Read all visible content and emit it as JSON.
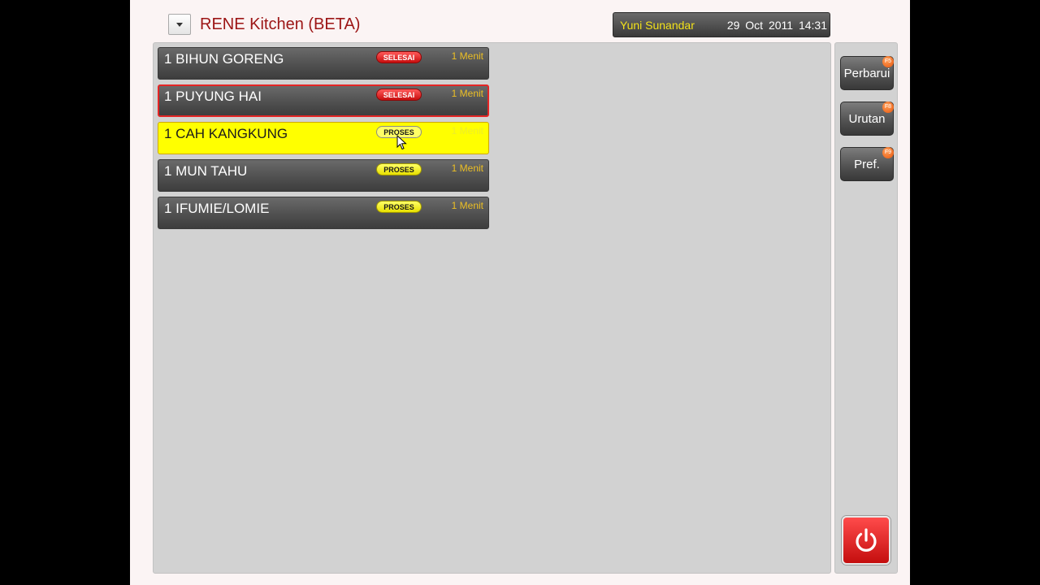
{
  "header": {
    "title": "RENE Kitchen (BETA)",
    "user": "Yuni Sunandar",
    "datetime": "29 Oct 2011 14:31"
  },
  "orders": [
    {
      "name": "1 BIHUN GORENG",
      "badge": "SELESAI",
      "time": "1 Menit",
      "state": "done"
    },
    {
      "name": "1 PUYUNG HAI",
      "badge": "SELESAI",
      "time": "1 Menit",
      "state": "done-alert"
    },
    {
      "name": "1 CAH KANGKUNG",
      "badge": "PROSES",
      "time": "1 Menit",
      "state": "processing-selected"
    },
    {
      "name": "1 MUN TAHU",
      "badge": "PROSES",
      "time": "1 Menit",
      "state": "processing"
    },
    {
      "name": "1 IFUMIE/LOMIE",
      "badge": "PROSES",
      "time": "1 Menit",
      "state": "processing"
    }
  ],
  "sidebar": {
    "buttons": [
      {
        "label": "Perbarui",
        "key": "F5"
      },
      {
        "label": "Urutan",
        "key": "F8"
      },
      {
        "label": "Pref.",
        "key": "F9"
      }
    ],
    "power_icon": "power-icon"
  },
  "colors": {
    "title": "#9c1515",
    "user_name": "#f3e21a",
    "selected_row": "#ffff00",
    "done_badge": "#e01818",
    "proses_badge": "#f3ef00",
    "time_text": "#ecbf24",
    "power_button": "#e01818"
  }
}
